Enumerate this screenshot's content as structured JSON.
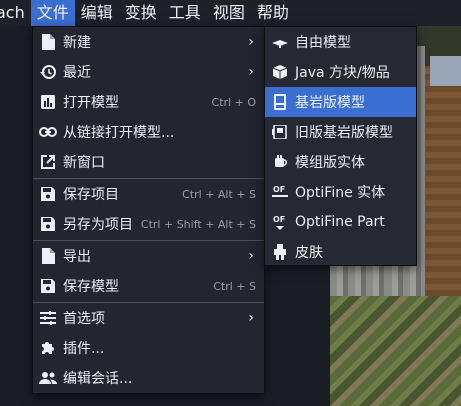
{
  "menubar": {
    "items": [
      {
        "label": "ach"
      },
      {
        "label": "文件"
      },
      {
        "label": "编辑"
      },
      {
        "label": "变换"
      },
      {
        "label": "工具"
      },
      {
        "label": "视图"
      },
      {
        "label": "帮助"
      }
    ],
    "active_index": 1
  },
  "file_menu": {
    "items": [
      {
        "label": "新建",
        "shortcut": "",
        "has_submenu": true,
        "icon": "new-file-icon"
      },
      {
        "label": "最近",
        "shortcut": "",
        "has_submenu": true,
        "icon": "history-icon"
      },
      {
        "label": "打开模型",
        "shortcut": "Ctrl + O",
        "has_submenu": false,
        "icon": "bar-chart-icon"
      },
      {
        "label": "从链接打开模型...",
        "shortcut": "",
        "has_submenu": false,
        "icon": "link-icon"
      },
      {
        "label": "新窗口",
        "shortcut": "",
        "has_submenu": false,
        "icon": "open-in-new-icon"
      },
      {
        "label": "保存项目",
        "shortcut": "Ctrl + Alt + S",
        "has_submenu": false,
        "icon": "save-icon"
      },
      {
        "label": "另存为项目",
        "shortcut": "Ctrl + Shift + Alt + S",
        "has_submenu": false,
        "icon": "save-icon"
      },
      {
        "label": "导出",
        "shortcut": "",
        "has_submenu": true,
        "icon": "new-file-icon"
      },
      {
        "label": "保存模型",
        "shortcut": "Ctrl + S",
        "has_submenu": false,
        "icon": "save-icon"
      },
      {
        "label": "首选项",
        "shortcut": "",
        "has_submenu": true,
        "icon": "tune-icon"
      },
      {
        "label": "插件...",
        "shortcut": "",
        "has_submenu": false,
        "icon": "extension-icon"
      },
      {
        "label": "编辑会话...",
        "shortcut": "",
        "has_submenu": false,
        "icon": "people-icon"
      }
    ]
  },
  "new_submenu": {
    "items": [
      {
        "label": "自由模型",
        "icon": "free-model-icon"
      },
      {
        "label": "Java 方块/物品",
        "icon": "java-block-icon"
      },
      {
        "label": "基岩版模型",
        "icon": "bedrock-model-icon"
      },
      {
        "label": "旧版基岩版模型",
        "icon": "legacy-bedrock-icon"
      },
      {
        "label": "模组版实体",
        "icon": "modded-entity-icon"
      },
      {
        "label": "OptiFine 实体",
        "icon": "optifine-icon"
      },
      {
        "label": "OptiFine Part",
        "icon": "optifine-icon"
      },
      {
        "label": "皮肤",
        "icon": "skin-icon"
      }
    ],
    "highlighted_index": 2
  },
  "colors": {
    "highlight": "#3a6fd1",
    "menu_bg": "#232530",
    "text": "#eef0f6",
    "shortcut": "#9a9cab"
  }
}
